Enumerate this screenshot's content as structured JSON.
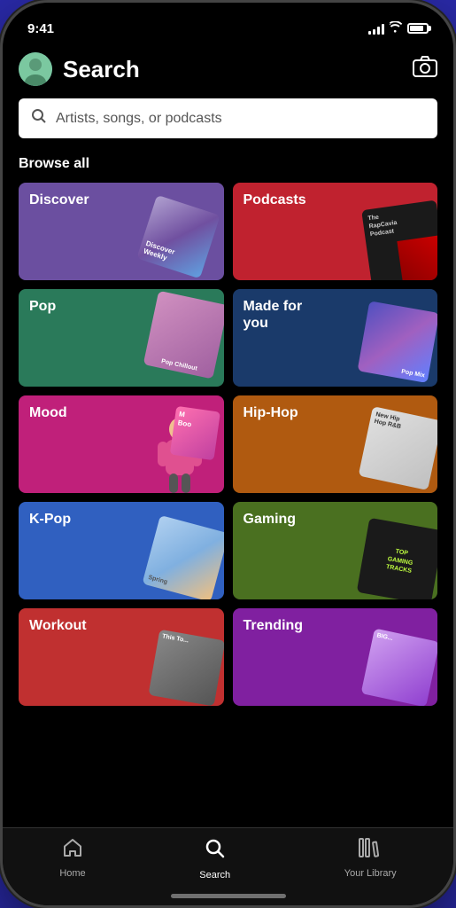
{
  "statusBar": {
    "time": "9:41",
    "signalBars": [
      4,
      6,
      8,
      11,
      14
    ],
    "batteryPercent": 85
  },
  "header": {
    "title": "Search",
    "cameraLabel": "camera"
  },
  "searchBar": {
    "placeholder": "Artists, songs, or podcasts"
  },
  "browseSection": {
    "label": "Browse all"
  },
  "categories": [
    {
      "id": "discover",
      "label": "Discover",
      "colorClass": "card-discover"
    },
    {
      "id": "podcasts",
      "label": "Podcasts",
      "colorClass": "card-podcasts"
    },
    {
      "id": "pop",
      "label": "Pop",
      "colorClass": "card-pop"
    },
    {
      "id": "madeforyou",
      "label": "Made for\nyou",
      "colorClass": "card-madeforyou"
    },
    {
      "id": "mood",
      "label": "Mood",
      "colorClass": "card-mood"
    },
    {
      "id": "hiphop",
      "label": "Hip-Hop",
      "colorClass": "card-hiphop"
    },
    {
      "id": "kpop",
      "label": "K-Pop",
      "colorClass": "card-kpop"
    },
    {
      "id": "gaming",
      "label": "Gaming",
      "colorClass": "card-gaming"
    },
    {
      "id": "workout",
      "label": "Workout",
      "colorClass": "card-workout"
    },
    {
      "id": "trending",
      "label": "Trending",
      "colorClass": "card-trending"
    }
  ],
  "bottomNav": {
    "items": [
      {
        "id": "home",
        "label": "Home",
        "icon": "🏠",
        "active": false
      },
      {
        "id": "search",
        "label": "Search",
        "icon": "🔍",
        "active": true
      },
      {
        "id": "library",
        "label": "Your Library",
        "icon": "📚",
        "active": false
      }
    ]
  }
}
